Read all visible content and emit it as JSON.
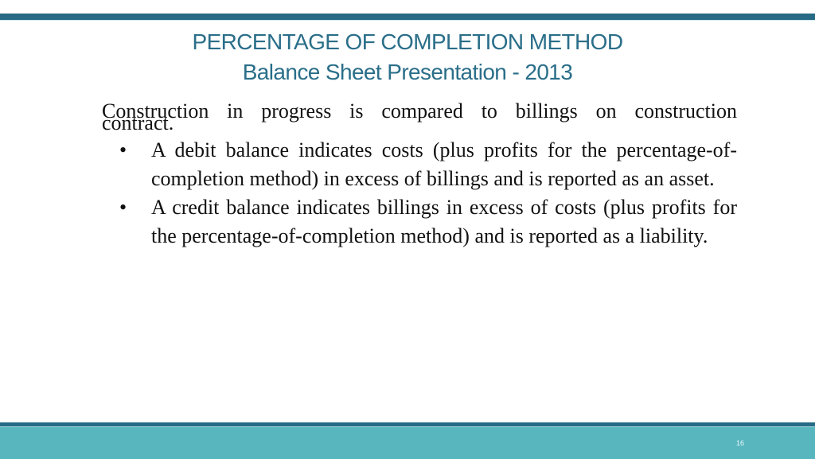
{
  "slide": {
    "title": "PERCENTAGE OF COMPLETION METHOD",
    "subtitle": "Balance Sheet Presentation - 2013",
    "intro_line1": "Construction in progress is compared to billings on construction",
    "intro_line2": "contract.",
    "bullets": [
      {
        "marker": "•",
        "text": "A debit balance indicates costs (plus profits for the percentage-of-completion method) in excess of billings and is reported as an asset."
      },
      {
        "marker": "•",
        "text": "A credit balance indicates billings in excess of costs (plus profits for the percentage-of-completion method) and is reported as a liability."
      }
    ],
    "page_number": "16"
  },
  "colors": {
    "title": "#2a6e89",
    "top_bar": "#266a85",
    "footer_dark": "#266a85",
    "footer_light": "#58b6bf"
  }
}
